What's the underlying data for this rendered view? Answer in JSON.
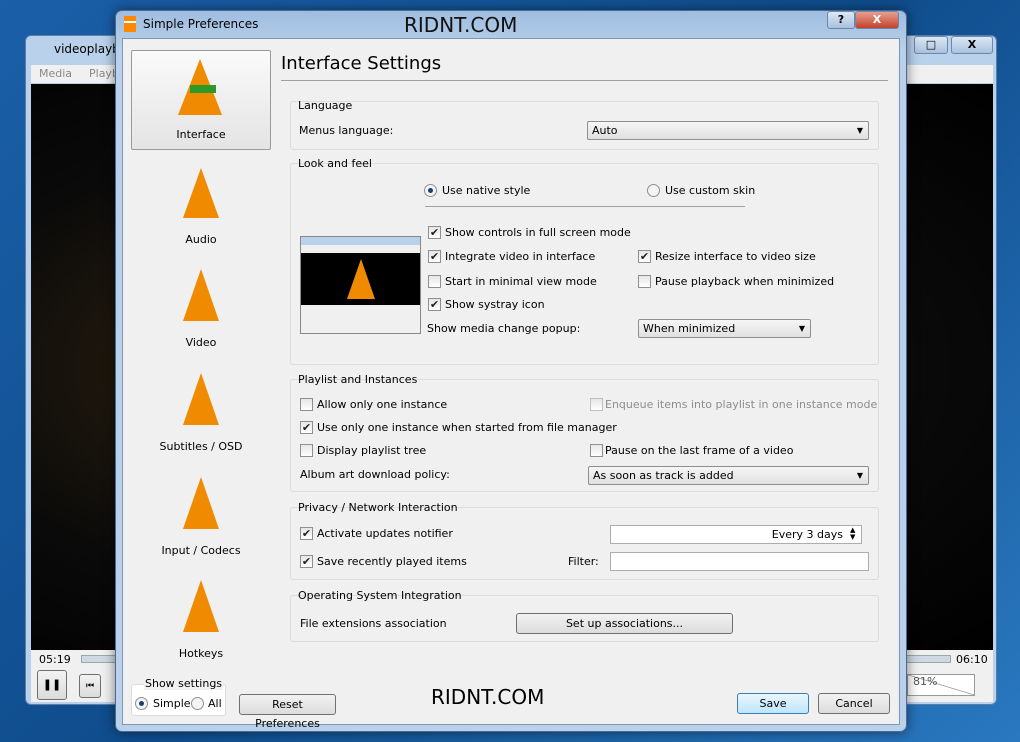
{
  "background_window": {
    "title": "videoplayb",
    "menu": [
      "Media",
      "Playb"
    ],
    "time_elapsed": "05:19",
    "time_total": "06:10",
    "volume": "81%"
  },
  "dialog": {
    "title": "Simple Preferences",
    "watermark_top": "RIDNT.COM",
    "watermark_bottom": "RIDNT.COM",
    "help_label": "?",
    "close_label": "X"
  },
  "sidebar": {
    "items": [
      {
        "label": "Interface",
        "icon": "vlc-cone-icon",
        "selected": true
      },
      {
        "label": "Audio",
        "icon": "headphones-cone-icon"
      },
      {
        "label": "Video",
        "icon": "glasses-cone-icon"
      },
      {
        "label": "Subtitles / OSD",
        "icon": "subtitles-cone-icon"
      },
      {
        "label": "Input / Codecs",
        "icon": "cable-cone-icon"
      },
      {
        "label": "Hotkeys",
        "icon": "keyboard-cone-icon"
      }
    ]
  },
  "main": {
    "title": "Interface Settings",
    "language": {
      "header": "Language",
      "menus_language_label": "Menus language:",
      "menus_language_value": "Auto"
    },
    "look": {
      "header": "Look and feel",
      "native_style": "Use native style",
      "custom_skin": "Use custom skin",
      "native_selected": true,
      "checks": [
        {
          "label": "Show controls in full screen mode",
          "checked": true
        },
        {
          "label": "Integrate video in interface",
          "checked": true
        },
        {
          "label": "Resize interface to video size",
          "checked": true
        },
        {
          "label": "Start in minimal view mode",
          "checked": false
        },
        {
          "label": "Pause playback when minimized",
          "checked": false
        },
        {
          "label": "Show systray icon",
          "checked": true
        }
      ],
      "popup_label": "Show media change popup:",
      "popup_value": "When minimized"
    },
    "playlist": {
      "header": "Playlist and Instances",
      "checks": [
        {
          "label": "Allow only one instance",
          "checked": false
        },
        {
          "label": "Enqueue items into playlist in one instance mode",
          "checked": false,
          "disabled": true
        },
        {
          "label": "Use only one instance when started from file manager",
          "checked": true
        },
        {
          "label": "Display playlist tree",
          "checked": false
        },
        {
          "label": "Pause on the last frame of a video",
          "checked": false
        }
      ],
      "album_label": "Album art download policy:",
      "album_value": "As soon as track is added"
    },
    "privacy": {
      "header": "Privacy / Network Interaction",
      "updates_label": "Activate updates notifier",
      "updates_checked": true,
      "updates_interval": "Every 3 days",
      "recent_label": "Save recently played items",
      "recent_checked": true,
      "filter_label": "Filter:",
      "filter_value": ""
    },
    "os": {
      "header": "Operating System Integration",
      "assoc_label": "File extensions association",
      "assoc_button": "Set up associations..."
    }
  },
  "footer": {
    "show_settings": "Show settings",
    "simple": "Simple",
    "all": "All",
    "simple_selected": true,
    "reset": "Reset Preferences",
    "save": "Save",
    "cancel": "Cancel"
  }
}
